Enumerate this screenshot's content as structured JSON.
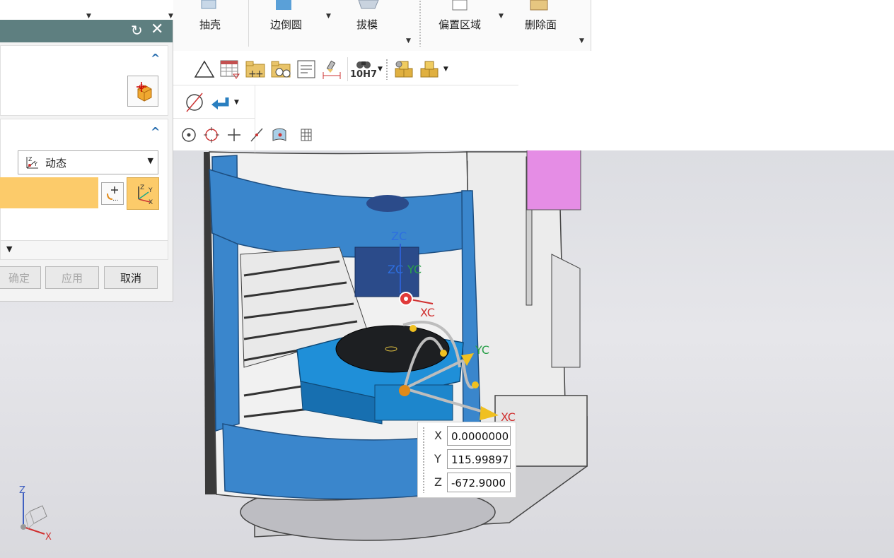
{
  "ribbon": {
    "shell_label": "抽壳",
    "edge_round_label": "边倒圆",
    "draft_label": "拔模",
    "offset_region_label": "偏置区域",
    "delete_face_label": "删除面"
  },
  "toolbar": {
    "tolerance_label": "10H7"
  },
  "dialog": {
    "orientation_type": "动态",
    "buttons": {
      "ok": "确定",
      "apply": "应用",
      "cancel": "取消"
    }
  },
  "wcs_labels": {
    "zc": "ZC",
    "yc": "YC",
    "xc": "XC"
  },
  "coordinates": {
    "x_label": "X",
    "y_label": "Y",
    "z_label": "Z",
    "x_value": "0.0000000",
    "y_value": "115.99897",
    "z_value": "-672.9000"
  },
  "triad": {
    "z_label": "Z",
    "x_label": "X"
  },
  "colors": {
    "dialog_title_bar": "#5e7f80",
    "selection_highlight": "#fccb6a",
    "machine_blue": "#3a86cc",
    "fixture_magenta": "#e070e0",
    "accent_blue": "#2a6fb0"
  }
}
